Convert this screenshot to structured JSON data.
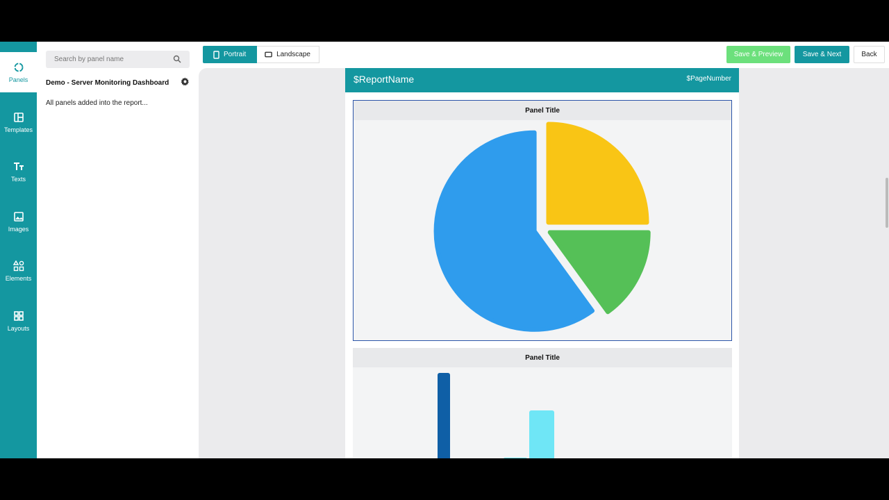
{
  "rail": {
    "items": [
      {
        "label": "Panels",
        "icon": "panels-icon"
      },
      {
        "label": "Templates",
        "icon": "templates-icon"
      },
      {
        "label": "Texts",
        "icon": "text-icon"
      },
      {
        "label": "Images",
        "icon": "image-icon"
      },
      {
        "label": "Elements",
        "icon": "elements-icon"
      },
      {
        "label": "Layouts",
        "icon": "layouts-icon"
      }
    ]
  },
  "sidebar": {
    "search_placeholder": "Search by panel name",
    "dashboard_name": "Demo - Server Monitoring Dashboard",
    "status": "All panels added into the report..."
  },
  "toolbar": {
    "portrait_label": "Portrait",
    "landscape_label": "Landscape",
    "save_preview_label": "Save & Preview",
    "save_next_label": "Save & Next",
    "back_label": "Back"
  },
  "page": {
    "report_name": "$ReportName",
    "page_number": "$PageNumber"
  },
  "colors": {
    "accent": "#1497a0",
    "preview": "#6ce07c",
    "selected_border": "#2b54a8"
  },
  "chart_data": [
    {
      "type": "pie",
      "title": "Panel Title",
      "values": [
        60,
        25,
        15
      ],
      "colors": [
        "#2f9ced",
        "#f9c515",
        "#55c057"
      ]
    },
    {
      "type": "bar",
      "title": "Panel Title",
      "values": [
        100,
        32,
        70
      ],
      "colors": [
        "#0f5fa6",
        "#22e0f0",
        "#6fe6f6"
      ]
    }
  ]
}
